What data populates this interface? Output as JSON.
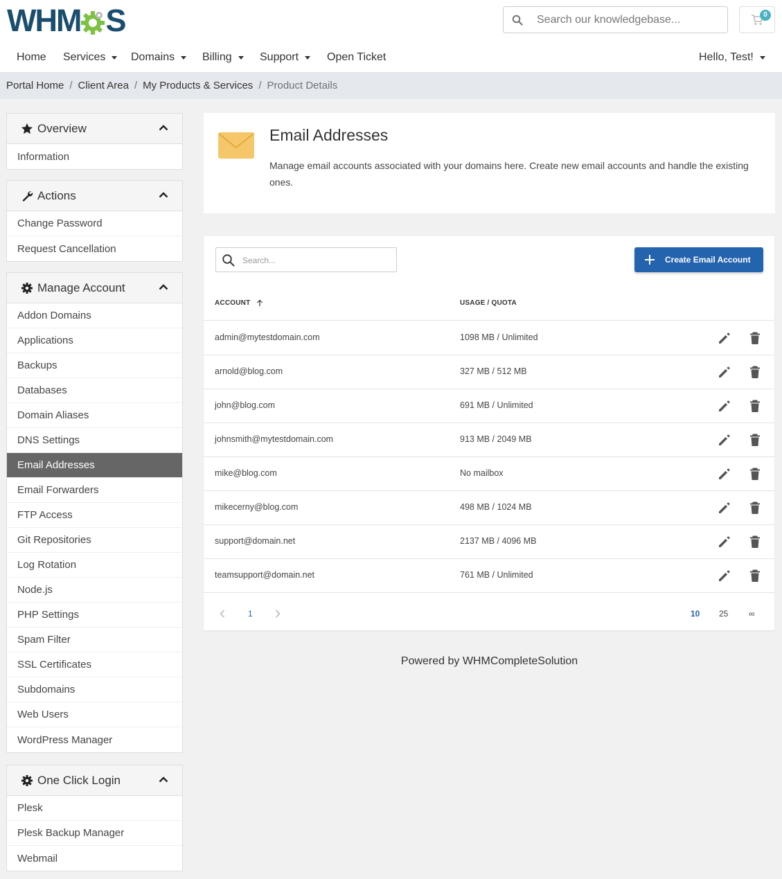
{
  "header": {
    "logo_text_left": "WHM",
    "logo_text_right": "S",
    "search_placeholder": "Search our knowledgebase...",
    "cart_count": "0",
    "nav": [
      {
        "label": "Home"
      },
      {
        "label": "Services"
      },
      {
        "label": "Domains"
      },
      {
        "label": "Billing"
      },
      {
        "label": "Support"
      },
      {
        "label": "Open Ticket"
      }
    ],
    "user_menu": "Hello, Test!"
  },
  "breadcrumb": [
    "Portal Home",
    "Client Area",
    "My Products & Services",
    "Product Details"
  ],
  "sidebar": {
    "overview": {
      "title": "Overview",
      "items": [
        "Information"
      ]
    },
    "actions": {
      "title": "Actions",
      "items": [
        "Change Password",
        "Request Cancellation"
      ]
    },
    "manage": {
      "title": "Manage Account",
      "items": [
        "Addon Domains",
        "Applications",
        "Backups",
        "Databases",
        "Domain Aliases",
        "DNS Settings",
        "Email Addresses",
        "Email Forwarders",
        "FTP Access",
        "Git Repositories",
        "Log Rotation",
        "Node.js",
        "PHP Settings",
        "Spam Filter",
        "SSL Certificates",
        "Subdomains",
        "Web Users",
        "WordPress Manager"
      ]
    },
    "oneclick": {
      "title": "One Click Login",
      "items": [
        "Plesk",
        "Plesk Backup Manager",
        "Webmail"
      ]
    }
  },
  "hero": {
    "title": "Email Addresses",
    "description": "Manage email accounts associated with your domains here. Create new email accounts and handle the existing ones."
  },
  "table": {
    "search_placeholder": "Search...",
    "create_label": "Create Email Account",
    "columns": [
      "ACCOUNT",
      "USAGE / QUOTA"
    ],
    "rows": [
      {
        "account": "admin@mytestdomain.com",
        "usage": "1098 MB / Unlimited"
      },
      {
        "account": "arnold@blog.com",
        "usage": "327 MB / 512 MB"
      },
      {
        "account": "john@blog.com",
        "usage": "691 MB / Unlimited"
      },
      {
        "account": "johnsmith@mytestdomain.com",
        "usage": "913 MB / 2049 MB"
      },
      {
        "account": "mike@blog.com",
        "usage": "No mailbox"
      },
      {
        "account": "mikecerny@blog.com",
        "usage": "498 MB / 1024 MB"
      },
      {
        "account": "support@domain.net",
        "usage": "2137 MB / 4096 MB"
      },
      {
        "account": "teamsupport@domain.net",
        "usage": "761 MB / Unlimited"
      }
    ],
    "pagination": {
      "current_page": "1",
      "page_sizes": [
        "10",
        "25",
        "∞"
      ],
      "selected_size": "10"
    }
  },
  "footer": {
    "text": "Powered by WHMCompleteSolution"
  },
  "colors": {
    "primary": "#2463ad",
    "logo": "#1a4d6e",
    "gear": "#7dc142",
    "active_item": "#666666",
    "envelope": "#f5c76a"
  }
}
